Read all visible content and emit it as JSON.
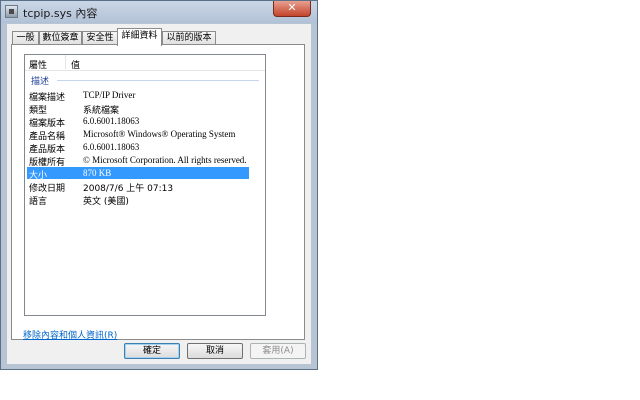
{
  "window": {
    "title": "tcpip.sys 內容",
    "close_label": "✕"
  },
  "tabs": [
    {
      "label": "一般"
    },
    {
      "label": "數位簽章"
    },
    {
      "label": "安全性"
    },
    {
      "label": "詳細資料"
    },
    {
      "label": "以前的版本"
    }
  ],
  "details": {
    "headers": {
      "property": "屬性",
      "value": "值"
    },
    "group": "描述",
    "rows": [
      {
        "property": "檔案描述",
        "value": "TCP/IP Driver"
      },
      {
        "property": "類型",
        "value": "系統檔案"
      },
      {
        "property": "檔案版本",
        "value": "6.0.6001.18063"
      },
      {
        "property": "產品名稱",
        "value": "Microsoft® Windows® Operating System"
      },
      {
        "property": "產品版本",
        "value": "6.0.6001.18063"
      },
      {
        "property": "版權所有",
        "value": "© Microsoft Corporation. All rights reserved."
      },
      {
        "property": "大小",
        "value": "870 KB"
      },
      {
        "property": "修改日期",
        "value": "2008/7/6 上午 07:13"
      },
      {
        "property": "語言",
        "value": "英文 (美國)"
      }
    ]
  },
  "remove_link": "移除內容和個人資訊(R)",
  "buttons": {
    "ok": "確定",
    "cancel": "取消",
    "apply": "套用(A)"
  }
}
